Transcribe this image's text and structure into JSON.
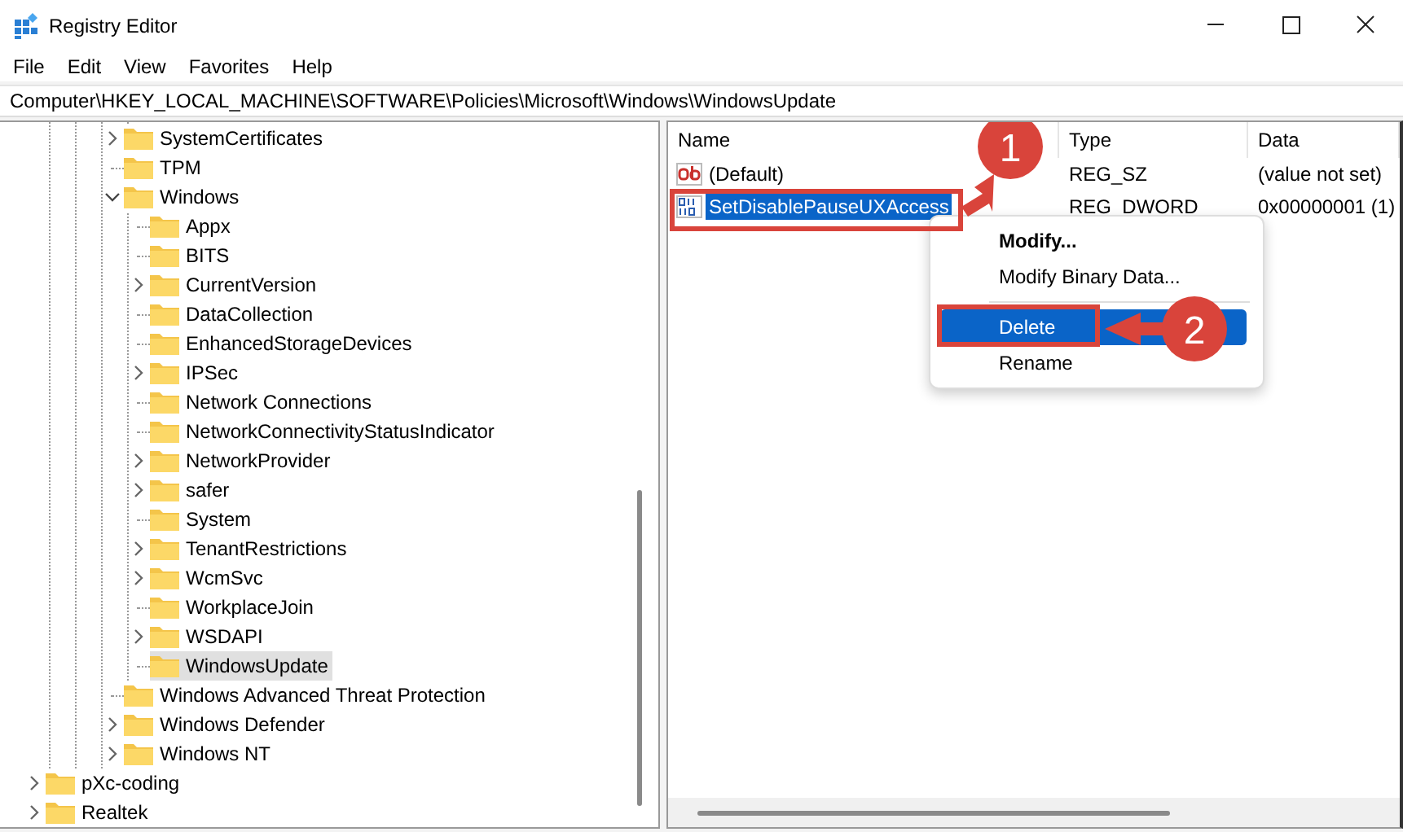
{
  "window": {
    "title": "Registry Editor"
  },
  "menu": [
    "File",
    "Edit",
    "View",
    "Favorites",
    "Help"
  ],
  "address": "Computer\\HKEY_LOCAL_MACHINE\\SOFTWARE\\Policies\\Microsoft\\Windows\\WindowsUpdate",
  "tree": [
    {
      "children": [
        {
          "children": [
            {
              "label": "SystemCertificates",
              "expandable": true,
              "expanded": false,
              "selected": false
            },
            {
              "label": "TPM",
              "expandable": false,
              "selected": false
            },
            {
              "label": "Windows",
              "expandable": true,
              "expanded": true,
              "selected": false,
              "children": [
                {
                  "label": "Appx",
                  "expandable": false,
                  "selected": false
                },
                {
                  "label": "BITS",
                  "expandable": false,
                  "selected": false
                },
                {
                  "label": "CurrentVersion",
                  "expandable": true,
                  "expanded": false,
                  "selected": false
                },
                {
                  "label": "DataCollection",
                  "expandable": false,
                  "selected": false
                },
                {
                  "label": "EnhancedStorageDevices",
                  "expandable": false,
                  "selected": false
                },
                {
                  "label": "IPSec",
                  "expandable": true,
                  "expanded": false,
                  "selected": false
                },
                {
                  "label": "Network Connections",
                  "expandable": false,
                  "selected": false
                },
                {
                  "label": "NetworkConnectivityStatusIndicator",
                  "expandable": false,
                  "selected": false
                },
                {
                  "label": "NetworkProvider",
                  "expandable": true,
                  "expanded": false,
                  "selected": false
                },
                {
                  "label": "safer",
                  "expandable": true,
                  "expanded": false,
                  "selected": false
                },
                {
                  "label": "System",
                  "expandable": false,
                  "selected": false
                },
                {
                  "label": "TenantRestrictions",
                  "expandable": true,
                  "expanded": false,
                  "selected": false
                },
                {
                  "label": "WcmSvc",
                  "expandable": true,
                  "expanded": false,
                  "selected": false
                },
                {
                  "label": "WorkplaceJoin",
                  "expandable": false,
                  "selected": false
                },
                {
                  "label": "WSDAPI",
                  "expandable": true,
                  "expanded": false,
                  "selected": false
                },
                {
                  "label": "WindowsUpdate",
                  "expandable": false,
                  "selected": true
                }
              ]
            },
            {
              "label": "Windows Advanced Threat Protection",
              "expandable": false,
              "selected": false
            },
            {
              "label": "Windows Defender",
              "expandable": true,
              "expanded": false,
              "selected": false
            },
            {
              "label": "Windows NT",
              "expandable": true,
              "expanded": false,
              "selected": false
            }
          ]
        }
      ]
    },
    {
      "label": "pXc-coding",
      "expandable": true,
      "expanded": false,
      "selected": false
    },
    {
      "label": "Realtek",
      "expandable": true,
      "expanded": false,
      "selected": false
    }
  ],
  "values": {
    "columns": [
      "Name",
      "Type",
      "Data"
    ],
    "rows": [
      {
        "name": "(Default)",
        "type": "REG_SZ",
        "data": "(value not set)",
        "kind": "string",
        "selected": false
      },
      {
        "name": "SetDisablePauseUXAccess",
        "type": "REG_DWORD",
        "data": "0x00000001 (1)",
        "kind": "binary",
        "selected": true
      }
    ]
  },
  "context_menu": [
    {
      "label": "Modify...",
      "kind": "default",
      "selected": false
    },
    {
      "label": "Modify Binary Data...",
      "kind": "item",
      "selected": false
    },
    {
      "kind": "separator"
    },
    {
      "label": "Delete",
      "kind": "item",
      "selected": true
    },
    {
      "label": "Rename",
      "kind": "item",
      "selected": false
    }
  ],
  "callouts": [
    {
      "number": "1"
    },
    {
      "number": "2"
    }
  ]
}
